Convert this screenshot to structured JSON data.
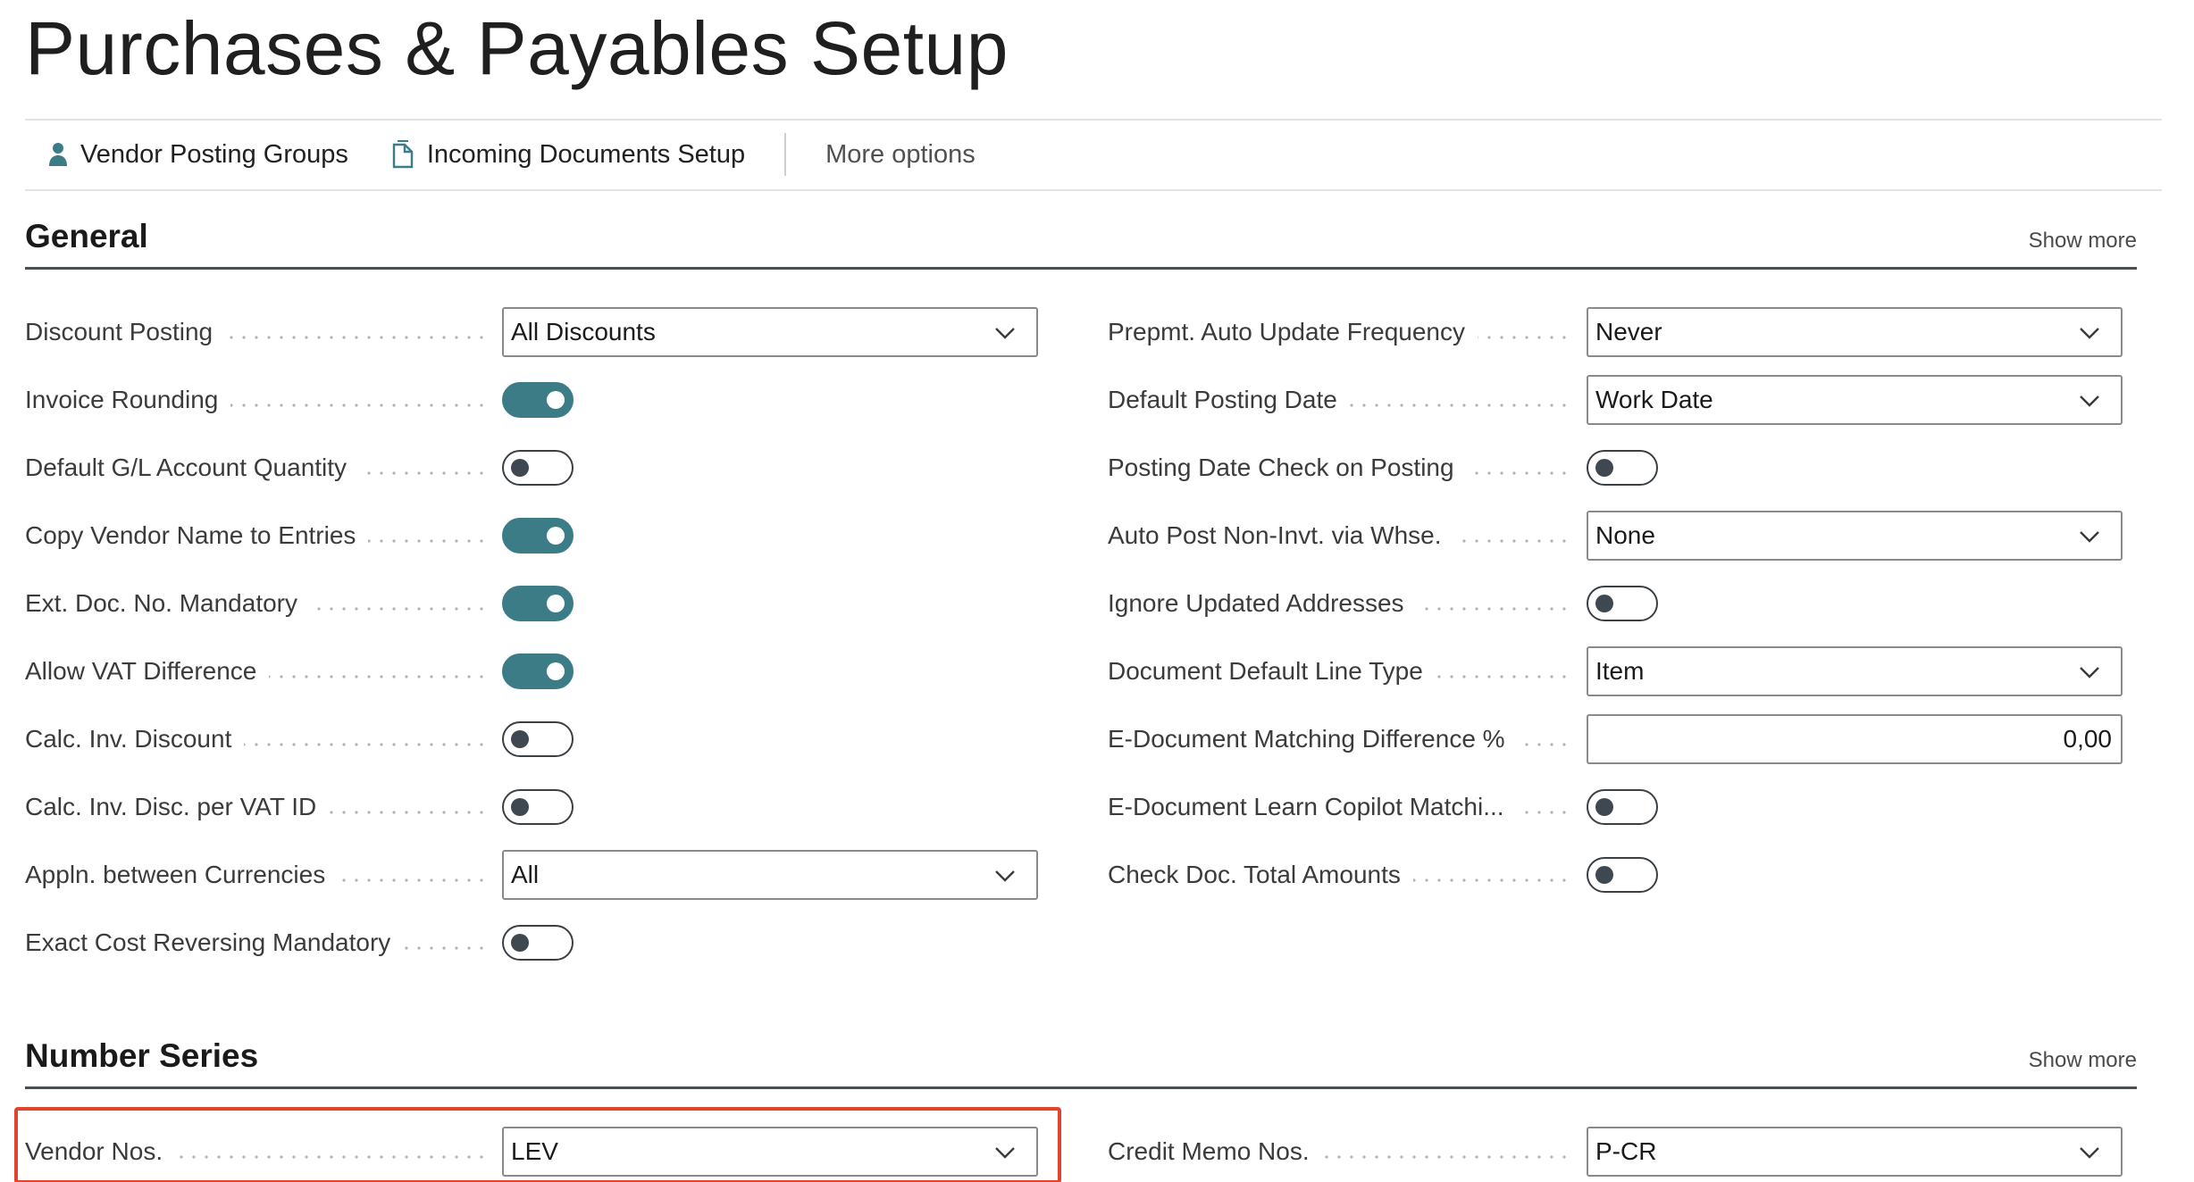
{
  "page": {
    "title": "Purchases & Payables Setup"
  },
  "actions": [
    {
      "label": "Vendor Posting Groups",
      "icon": "person-icon"
    },
    {
      "label": "Incoming Documents Setup",
      "icon": "document-icon"
    }
  ],
  "more_options": "More options",
  "colors": {
    "toggle_on": "#3b7c87",
    "highlight": "#e0452b",
    "section_rule": "#45505a"
  },
  "general": {
    "title": "General",
    "show_more": "Show more",
    "left": [
      {
        "label": "Discount Posting",
        "type": "select",
        "value": "All Discounts"
      },
      {
        "label": "Invoice Rounding",
        "type": "toggle",
        "value": true
      },
      {
        "label": "Default G/L Account Quantity",
        "type": "toggle",
        "value": false
      },
      {
        "label": "Copy Vendor Name to Entries",
        "type": "toggle",
        "value": true
      },
      {
        "label": "Ext. Doc. No. Mandatory",
        "type": "toggle",
        "value": true
      },
      {
        "label": "Allow VAT Difference",
        "type": "toggle",
        "value": true
      },
      {
        "label": "Calc. Inv. Discount",
        "type": "toggle",
        "value": false
      },
      {
        "label": "Calc. Inv. Disc. per VAT ID",
        "type": "toggle",
        "value": false
      },
      {
        "label": "Appln. between Currencies",
        "type": "select",
        "value": "All"
      },
      {
        "label": "Exact Cost Reversing Mandatory",
        "type": "toggle",
        "value": false
      }
    ],
    "right": [
      {
        "label": "Prepmt. Auto Update Frequency",
        "type": "select",
        "value": "Never"
      },
      {
        "label": "Default Posting Date",
        "type": "select",
        "value": "Work Date"
      },
      {
        "label": "Posting Date Check on Posting",
        "type": "toggle",
        "value": false
      },
      {
        "label": "Auto Post Non-Invt. via Whse.",
        "type": "select",
        "value": "None"
      },
      {
        "label": "Ignore Updated Addresses",
        "type": "toggle",
        "value": false
      },
      {
        "label": "Document Default Line Type",
        "type": "select",
        "value": "Item"
      },
      {
        "label": "E-Document Matching Difference %",
        "type": "text",
        "value": "0,00"
      },
      {
        "label": "E-Document Learn Copilot Matchi...",
        "type": "toggle",
        "value": false
      },
      {
        "label": "Check Doc. Total Amounts",
        "type": "toggle",
        "value": false
      }
    ]
  },
  "number_series": {
    "title": "Number Series",
    "show_more": "Show more",
    "left": [
      {
        "label": "Vendor Nos.",
        "type": "select",
        "value": "LEV"
      }
    ],
    "right": [
      {
        "label": "Credit Memo Nos.",
        "type": "select",
        "value": "P-CR"
      }
    ]
  }
}
